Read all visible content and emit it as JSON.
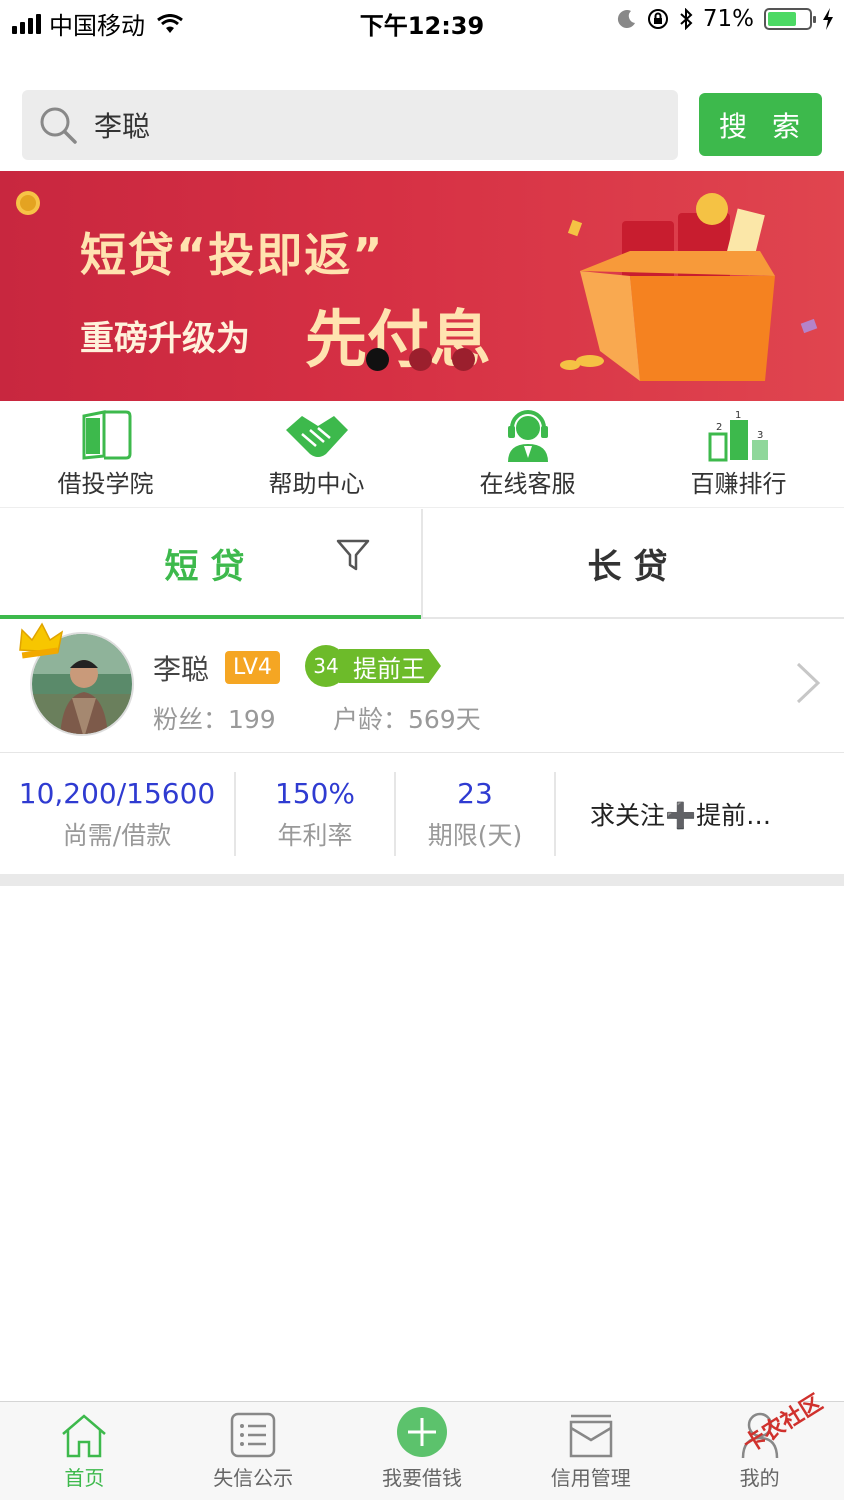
{
  "status_bar": {
    "carrier": "中国移动",
    "time": "下午12:39",
    "battery_pct": "71%",
    "battery_level": 0.71
  },
  "search": {
    "value": "李聪",
    "button_label": "搜 索"
  },
  "banner": {
    "line1": "短贷“投即返”",
    "line2": "重磅升级为",
    "line3": "先付息",
    "active_dot": 0,
    "dot_count": 3
  },
  "quick_nav": [
    {
      "label": "借投学院",
      "icon": "book-icon"
    },
    {
      "label": "帮助中心",
      "icon": "handshake-icon"
    },
    {
      "label": "在线客服",
      "icon": "headset-agent-icon"
    },
    {
      "label": "百赚排行",
      "icon": "podium-icon"
    }
  ],
  "tabs": {
    "short": "短贷",
    "long": "长贷",
    "active": "short"
  },
  "loan": {
    "name": "李聪",
    "level": "LV4",
    "medal_count": "34",
    "medal_title": "提前王",
    "fans": "粉丝：199",
    "account_age": "户龄：569天",
    "amount": "10,200/15600",
    "amount_label": "尚需/借款",
    "rate": "150%",
    "rate_label": "年利率",
    "term": "23",
    "term_label": "期限(天)",
    "note": "求关注➕提前…"
  },
  "bottom_nav": [
    {
      "label": "首页",
      "icon": "home-icon",
      "active": true
    },
    {
      "label": "失信公示",
      "icon": "list-icon",
      "active": false
    },
    {
      "label": "我要借钱",
      "icon": "plus-circle-icon",
      "active": false
    },
    {
      "label": "信用管理",
      "icon": "tray-icon",
      "active": false
    },
    {
      "label": "我的",
      "icon": "user-icon",
      "active": false
    }
  ],
  "watermark": "卡农社区",
  "colors": {
    "accent": "#3db94c",
    "banner_red": "#d63044",
    "stat_blue": "#2f3bd1",
    "level_orange": "#f5a623",
    "medal_green": "#6dbb2a"
  }
}
